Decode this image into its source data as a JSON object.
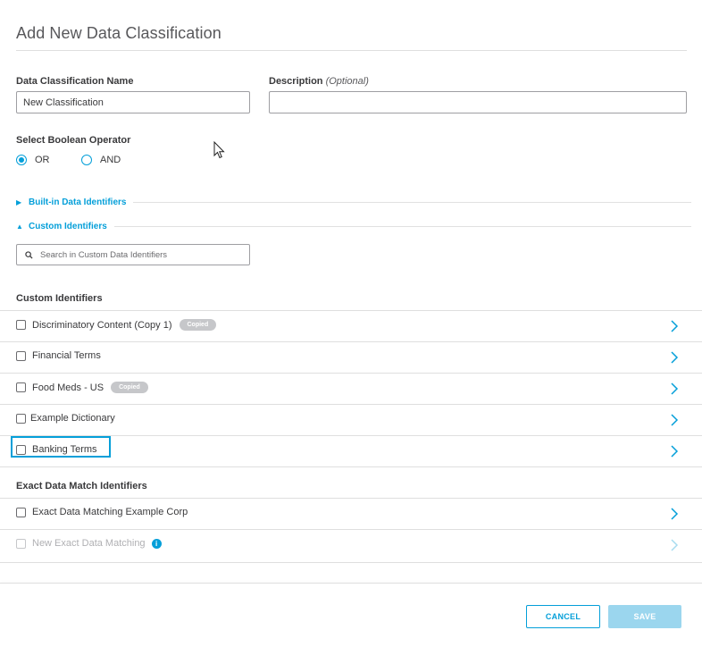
{
  "dialog": {
    "title": "Add New Data Classification"
  },
  "form": {
    "name_label": "Data Classification Name",
    "name_value": "New Classification",
    "description_label": "Description",
    "description_optional": "(Optional)",
    "description_value": "",
    "operator_label": "Select Boolean Operator",
    "operator_options": [
      {
        "label": "OR",
        "selected": true
      },
      {
        "label": "AND",
        "selected": false
      }
    ]
  },
  "sections": {
    "builtin_label": "Built-in Data Identifiers",
    "builtin_expanded": false,
    "custom_label": "Custom Identifiers",
    "custom_expanded": true
  },
  "search": {
    "placeholder": "Search in Custom Data Identifiers",
    "value": ""
  },
  "custom_identifiers": {
    "heading": "Custom Identifiers",
    "items": [
      {
        "label": "Discriminatory Content (Copy 1)",
        "badge": "Copied",
        "checked": false
      },
      {
        "label": "Financial Terms",
        "badge": "",
        "checked": false
      },
      {
        "label": "Food Meds - US",
        "badge": "Copied",
        "checked": false
      },
      {
        "label": "Example Dictionary",
        "badge": "",
        "checked": false
      },
      {
        "label": "Banking Terms",
        "badge": "",
        "checked": false,
        "focused": true
      }
    ]
  },
  "exact_match_identifiers": {
    "heading": "Exact Data Match Identifiers",
    "items": [
      {
        "label": "Exact Data Matching Example Corp",
        "checked": false,
        "disabled": false
      },
      {
        "label": "New Exact Data Matching",
        "checked": false,
        "disabled": true,
        "info_icon": "info-icon"
      }
    ]
  },
  "footer": {
    "cancel_label": "CANCEL",
    "save_label": "SAVE",
    "save_enabled": false
  },
  "colors": {
    "accent": "#049fd9",
    "disabled_button": "#9bd6ee",
    "badge": "#c6c7ca"
  }
}
